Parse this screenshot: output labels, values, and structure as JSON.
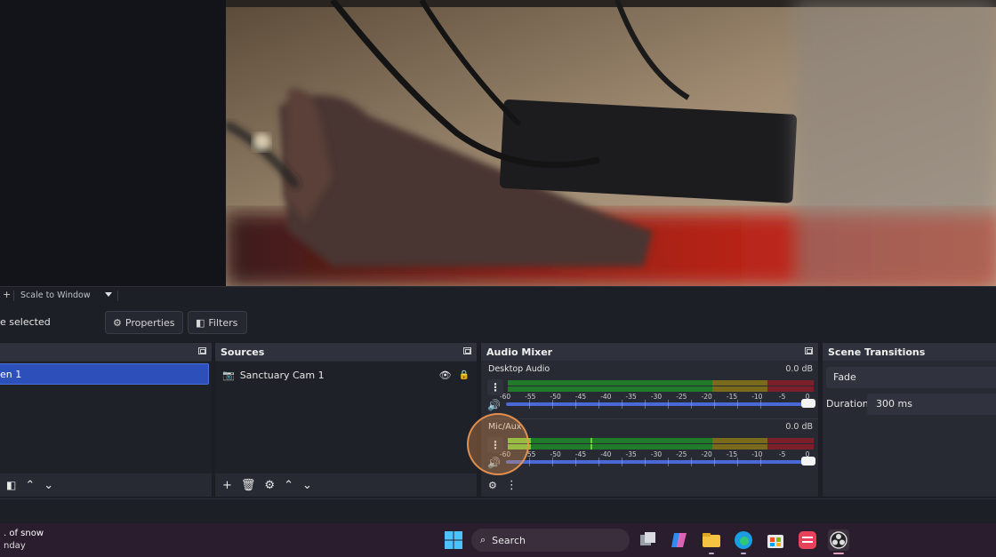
{
  "zoom_bar": {
    "add": "+",
    "scale_label": "Scale to Window"
  },
  "context": {
    "selection_label": "e selected",
    "properties_label": "Properties",
    "filters_label": "Filters"
  },
  "scenes": {
    "items": [
      "en 1"
    ]
  },
  "sources": {
    "title": "Sources",
    "items": [
      {
        "label": "Sanctuary Cam 1"
      }
    ]
  },
  "audio_mixer": {
    "title": "Audio Mixer",
    "channels": [
      {
        "name": "Desktop Audio",
        "db": "0.0 dB",
        "level": 0
      },
      {
        "name": "Mic/Aux",
        "db": "0.0 dB",
        "level": 0.075
      }
    ],
    "scale_ticks": [
      "-60",
      "-55",
      "-50",
      "-45",
      "-40",
      "-35",
      "-30",
      "-25",
      "-20",
      "-15",
      "-10",
      "-5",
      "0"
    ],
    "colors": {
      "green": "#1f7a2a",
      "yellow": "#7a6a1c",
      "red": "#7d1f2a",
      "active_green": "#6fcf3a",
      "slider": "#4a68d6"
    }
  },
  "transitions": {
    "title": "Scene Transitions",
    "selected": "Fade",
    "duration_label": "Duration",
    "duration_value": "300 ms"
  },
  "taskbar": {
    "weather_line1": ". of snow",
    "weather_line2": "nday",
    "search_placeholder": "Search",
    "icons": [
      "windows-start-icon",
      "task-view-icon",
      "copilot-icon",
      "file-explorer-icon",
      "edge-icon",
      "store-icon",
      "app-icon",
      "obs-icon"
    ]
  }
}
